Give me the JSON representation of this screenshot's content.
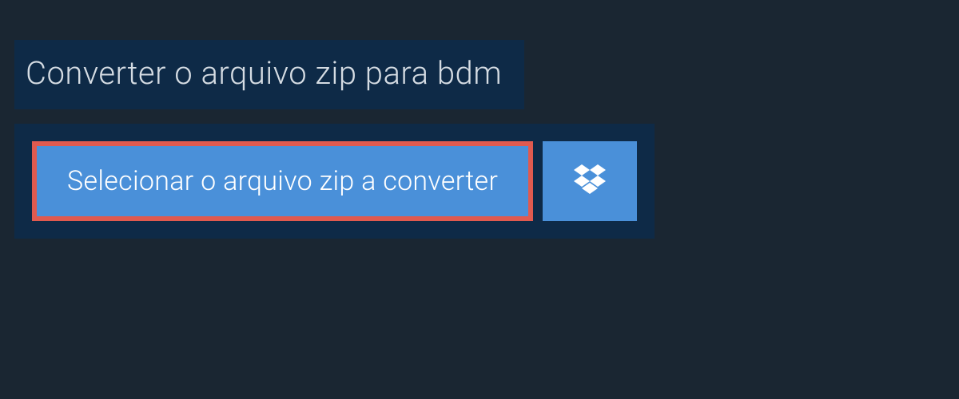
{
  "header": {
    "title": "Converter o arquivo zip para bdm"
  },
  "actions": {
    "select_label": "Selecionar o arquivo zip a converter",
    "dropbox_icon": "dropbox-icon"
  }
}
